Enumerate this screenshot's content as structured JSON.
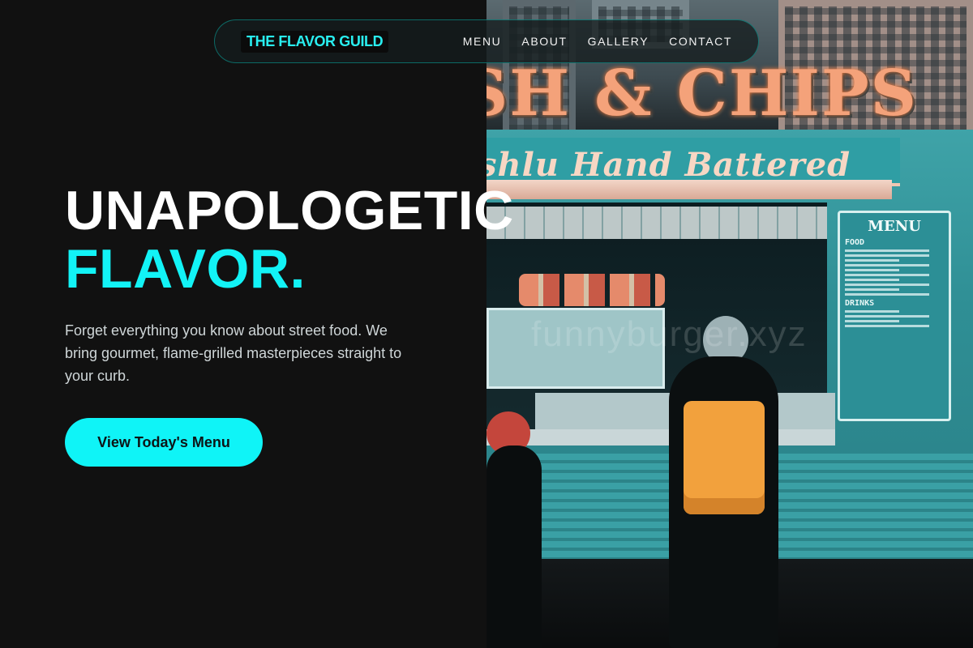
{
  "nav": {
    "brand": "THE FLAVOR GUILD",
    "links": [
      "MENU",
      "ABOUT",
      "GALLERY",
      "CONTACT"
    ]
  },
  "hero": {
    "title_line1": "UNAPOLOGETIC",
    "title_line2": "FLAVOR.",
    "subtitle": "Forget everything you know about street food. We bring gourmet, flame-grilled masterpieces straight to your curb.",
    "cta_label": "View Today's Menu"
  },
  "photo": {
    "sign_text": "SH & CHIPS",
    "banner_text": "shlu Hand Battered",
    "menu_board_title": "MENU",
    "menu_board_food": "FOOD",
    "menu_board_drinks": "DRINKS",
    "watermark": "funnyburger.xyz"
  },
  "colors": {
    "accent": "#0ff4f7",
    "background": "#111111",
    "text_primary": "#ffffff",
    "text_secondary": "#cfd6d8"
  }
}
